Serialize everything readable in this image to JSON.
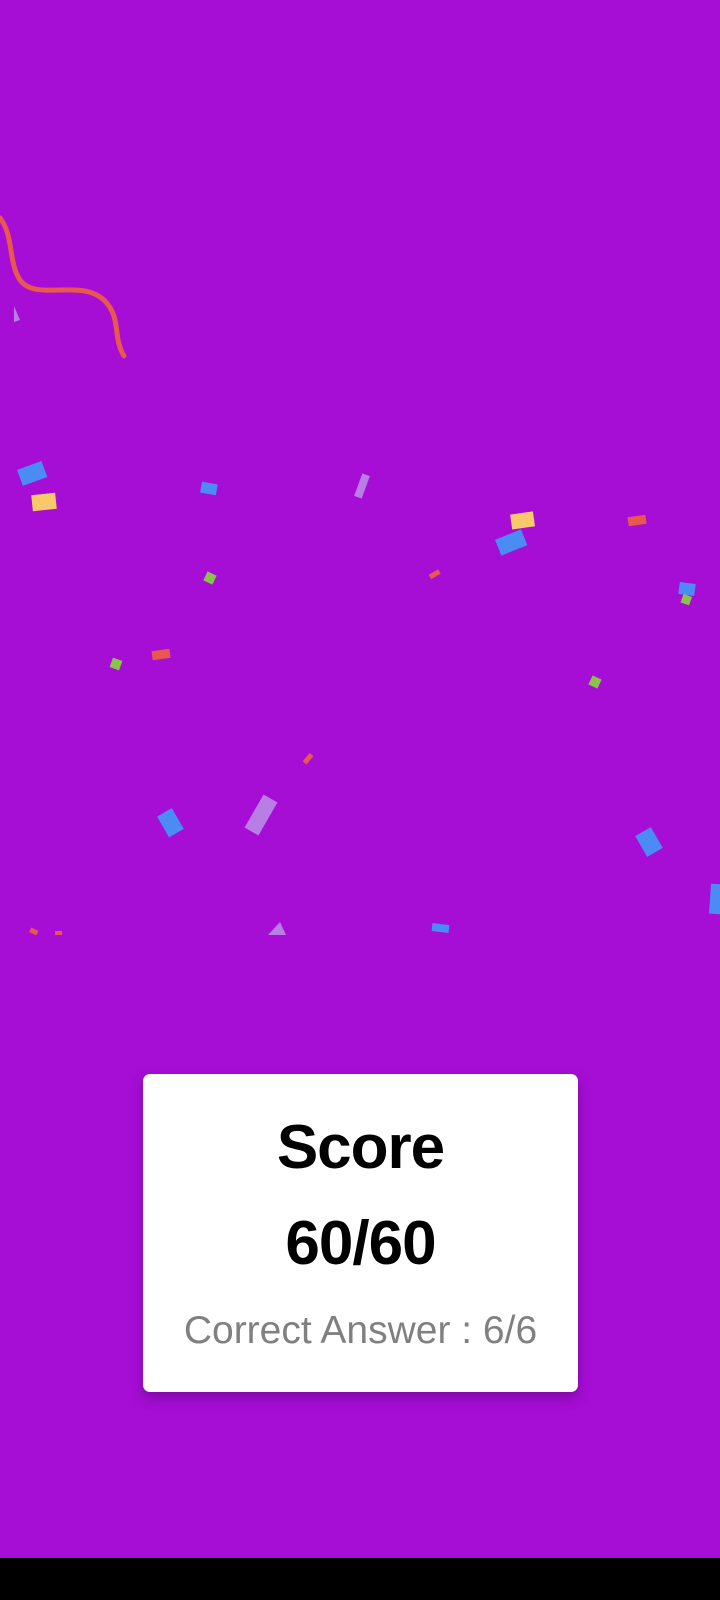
{
  "result": {
    "title": "Score",
    "score": "60/60",
    "correct_answer": "Correct Answer : 6/6"
  },
  "colors": {
    "background": "#a60dd5",
    "card": "#ffffff",
    "confetti_blue": "#4b8cf4",
    "confetti_yellow": "#f7c96b",
    "confetti_red": "#e8584f",
    "confetti_green": "#8bc34a",
    "confetti_lilac": "#b97de6"
  },
  "confetti": {
    "icon": "confetti-icon",
    "streamer_icon": "streamer-icon"
  }
}
